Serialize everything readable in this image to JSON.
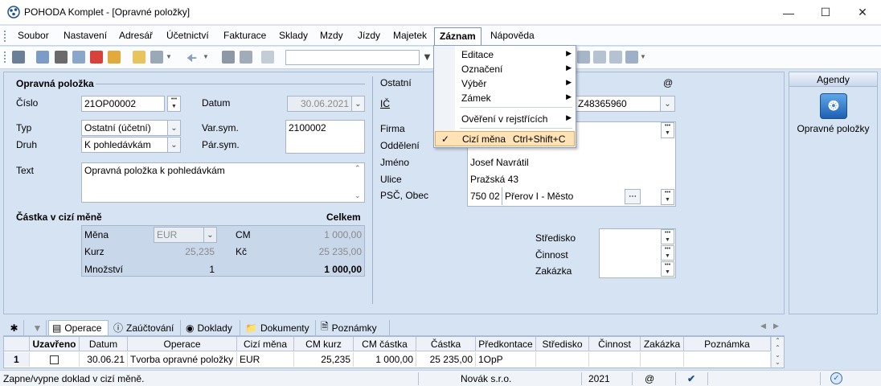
{
  "window": {
    "title": "POHODA Komplet - [Opravné položky]",
    "controls": [
      "minimize-icon",
      "maximize-icon",
      "close-icon"
    ]
  },
  "menu": {
    "items": [
      "Soubor",
      "Nastavení",
      "Adresář",
      "Účetnictví",
      "Fakturace",
      "Sklady",
      "Mzdy",
      "Jízdy",
      "Majetek",
      "Záznam",
      "Nápověda"
    ],
    "active": "Záznam"
  },
  "dropdown": {
    "items": [
      {
        "label": "Editace",
        "submenu": "▶"
      },
      {
        "label": "Označení",
        "submenu": "▶"
      },
      {
        "label": "Výběr",
        "submenu": "▶"
      },
      {
        "label": "Zámek",
        "submenu": "▶"
      },
      {
        "label": "Ověření v rejstřících",
        "submenu": "▶"
      },
      {
        "label": "Cizí měna",
        "shortcut": "Ctrl+Shift+C",
        "checked": "✓"
      }
    ]
  },
  "form": {
    "section_title": "Opravná položka",
    "cislo_label": "Číslo",
    "cislo_value": "21OP00002",
    "datum_label": "Datum",
    "datum_value": "30.06.2021",
    "typ_label": "Typ",
    "typ_value": "Ostatní (účetní)",
    "druh_label": "Druh",
    "druh_value": "K pohledávkám",
    "varsym_label": "Var.sym.",
    "varsym_value": "2100002",
    "parsym_label": "Pár.sym.",
    "text_label": "Text",
    "text_value": "Opravná položka k pohledávkám",
    "foreign_title": "Částka v cizí měně",
    "celkem_label": "Celkem",
    "mena_label": "Měna",
    "mena_value": "EUR",
    "cm_label": "CM",
    "cm_value": "1 000,00",
    "kurz_label": "Kurz",
    "kurz_value": "25,235",
    "kc_label": "Kč",
    "kc_value": "25 235,00",
    "mnozstvi_label": "Množství",
    "mnozstvi_value": "1",
    "total_value": "1 000,00"
  },
  "other": {
    "section_title": "Ostatní",
    "at_symbol": "@",
    "ic_label": "IČ",
    "ic_value": "Z48365960",
    "firma_label": "Firma",
    "oddeleni_label": "Oddělení",
    "jmeno_label": "Jméno",
    "jmeno_value": "Josef Navrátil",
    "ulice_label": "Ulice",
    "ulice_value": "Pražská 43",
    "psc_label": "PSČ, Obec",
    "psc_value": "750 02",
    "obec_value": "Přerov I - Město",
    "stredisko_label": "Středisko",
    "cinnost_label": "Činnost",
    "zakazka_label": "Zakázka"
  },
  "agendy": {
    "header": "Agendy",
    "item": "Opravné položky"
  },
  "tabs": [
    {
      "label": "Operace",
      "icon": "list-icon"
    },
    {
      "label": "Zaúčtování",
      "icon": "info-icon"
    },
    {
      "label": "Doklady",
      "icon": "circle-icon"
    },
    {
      "label": "Dokumenty",
      "icon": "folder-icon"
    },
    {
      "label": "Poznámky",
      "icon": "note-icon"
    }
  ],
  "grid": {
    "headers": [
      "Uzavřeno",
      "Datum",
      "Operace",
      "Cizí měna",
      "CM kurz",
      "CM částka",
      "Částka",
      "Předkontace",
      "Středisko",
      "Činnost",
      "Zakázka",
      "Poznámka"
    ],
    "row_num": "1",
    "row": [
      "",
      "30.06.21",
      "Tvorba opravné položky",
      "EUR",
      "25,235",
      "1 000,00",
      "25 235,00",
      "1OpP",
      "",
      "",
      "",
      ""
    ]
  },
  "status": {
    "hint": "Zapne/vypne doklad v cizí měně.",
    "company": "Novák s.r.o.",
    "year": "2021",
    "at": "@"
  }
}
